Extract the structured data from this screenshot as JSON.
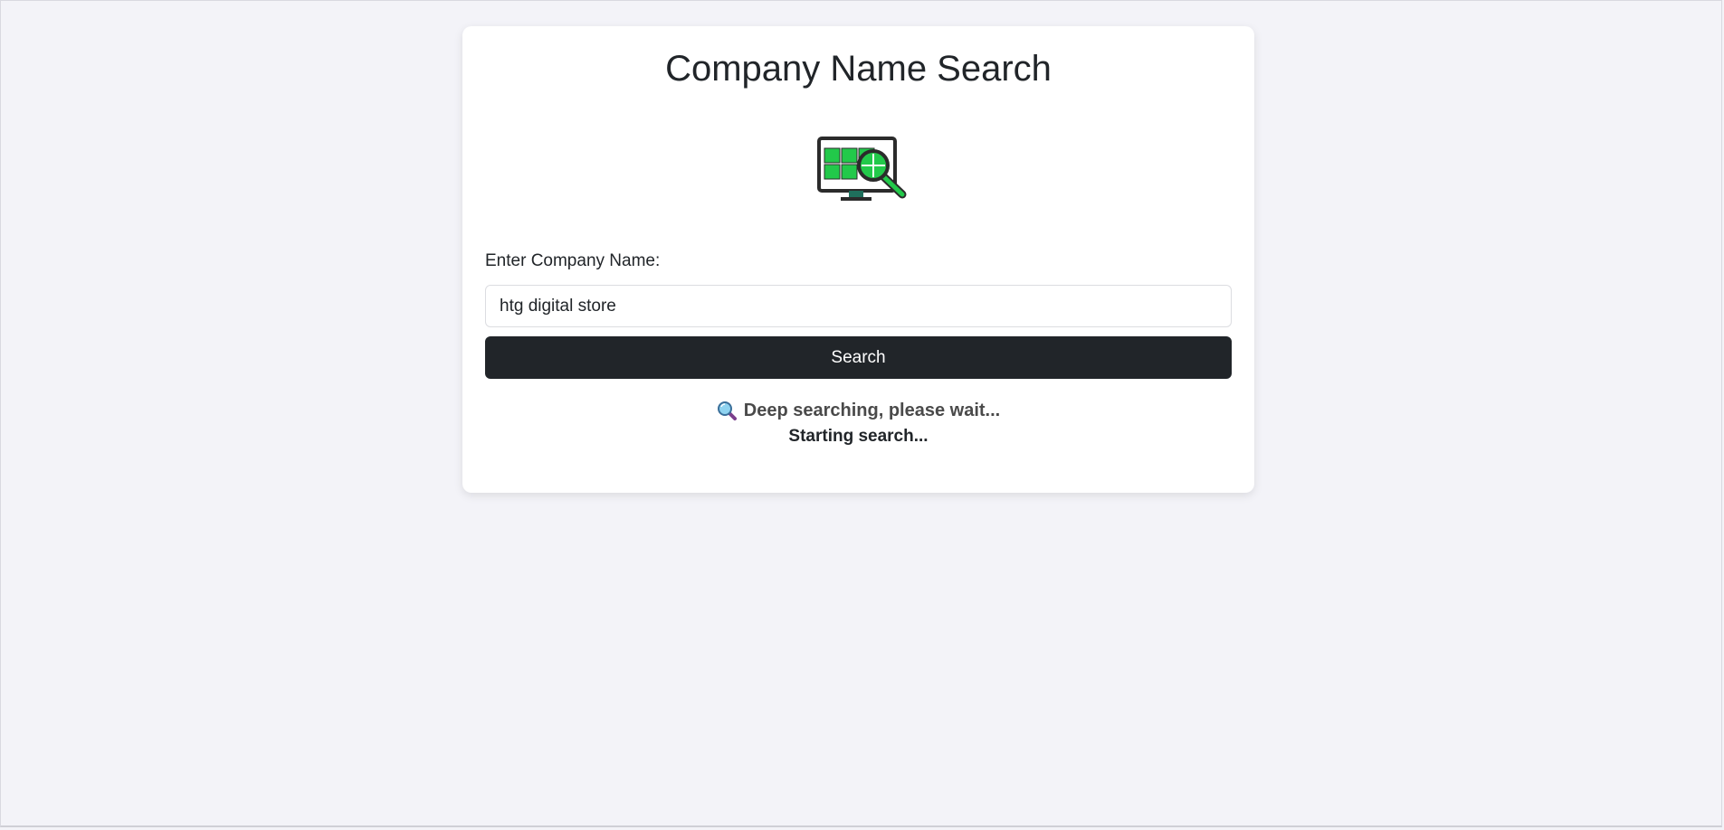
{
  "page": {
    "title": "Company Name Search"
  },
  "form": {
    "label": "Enter Company Name:",
    "input_value": "htg digital store",
    "button_label": "Search"
  },
  "status": {
    "icon": "magnifier-icon",
    "message": "Deep searching, please wait...",
    "progress_text": "Starting search..."
  },
  "colors": {
    "background": "#f3f3f8",
    "card": "#ffffff",
    "button": "#212529",
    "logo_green": "#22c94a",
    "logo_dark": "#2b2b2b"
  },
  "logo": {
    "icon": "monitor-search-icon"
  }
}
